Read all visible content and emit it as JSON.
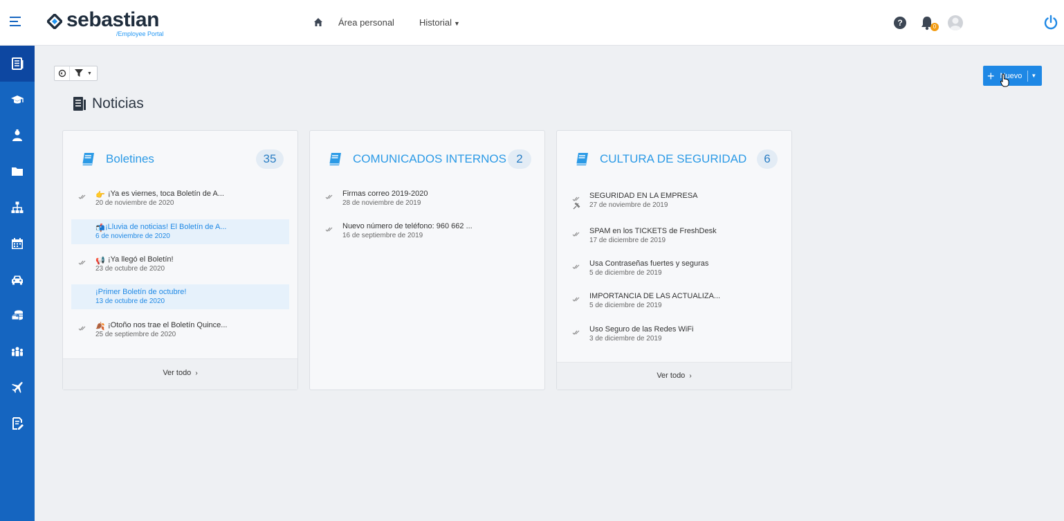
{
  "header": {
    "brand": "sebastian",
    "brand_sub": "/Employee Portal",
    "nav_area": "Área personal",
    "nav_history": "Historial",
    "help_symbol": "?",
    "notification_count": "0"
  },
  "sidebar": {
    "items": [
      {
        "icon": "newspaper-icon",
        "active": true
      },
      {
        "icon": "graduation-cap-icon"
      },
      {
        "icon": "user-badge-icon"
      },
      {
        "icon": "folder-icon"
      },
      {
        "icon": "org-chart-icon"
      },
      {
        "icon": "calendar-icon"
      },
      {
        "icon": "car-icon"
      },
      {
        "icon": "coins-icon"
      },
      {
        "icon": "team-icon"
      },
      {
        "icon": "plane-icon"
      },
      {
        "icon": "edit-document-icon"
      }
    ]
  },
  "toolbar": {
    "new_label": "Nuevo"
  },
  "page": {
    "title": "Noticias"
  },
  "cards": [
    {
      "title": "Boletines",
      "count": "35",
      "items": [
        {
          "emoji": "👉",
          "title": "¡Ya es viernes, toca Boletín de A...",
          "date": "20 de noviembre de 2020",
          "read": true,
          "highlight": false
        },
        {
          "emoji": "📬",
          "title": "¡Lluvia de noticias! El Boletín de A...",
          "date": "6 de noviembre de 2020",
          "read": false,
          "highlight": true
        },
        {
          "emoji": "📢",
          "title": "¡Ya llegó el Boletín!",
          "date": "23 de octubre de 2020",
          "read": true,
          "highlight": false
        },
        {
          "emoji": "",
          "title": "¡Primer Boletín de octubre!",
          "date": "13 de octubre de 2020",
          "read": false,
          "highlight": true
        },
        {
          "emoji": "🍂",
          "title": "¡Otoño nos trae el Boletín Quince...",
          "date": "25 de septiembre de 2020",
          "read": true,
          "highlight": false
        }
      ],
      "footer": "Ver todo"
    },
    {
      "title": "COMUNICADOS INTERNOS",
      "count": "2",
      "items": [
        {
          "title": "Firmas correo 2019-2020",
          "date": "28 de noviembre de 2019",
          "read": true
        },
        {
          "title": "Nuevo número de teléfono: 960 662 ...",
          "date": "16 de septiembre de 2019",
          "read": true
        }
      ]
    },
    {
      "title": "CULTURA DE SEGURIDAD",
      "count": "6",
      "items": [
        {
          "title": "SEGURIDAD EN LA EMPRESA",
          "date": "27 de noviembre de 2019",
          "read": true
        },
        {
          "title": "SPAM en los TICKETS de FreshDesk",
          "date": "17 de diciembre de 2019",
          "read": true
        },
        {
          "title": "Usa Contraseñas fuertes y seguras",
          "date": "5 de diciembre de 2019",
          "read": true
        },
        {
          "title": "IMPORTANCIA DE LAS ACTUALIZA...",
          "date": "5 de diciembre de 2019",
          "read": true
        },
        {
          "title": "Uso Seguro de las Redes WiFi",
          "date": "3 de diciembre de 2019",
          "read": true
        }
      ],
      "footer": "Ver todo"
    }
  ],
  "colors": {
    "primary": "#1565c0",
    "accent": "#1e88e5",
    "card_title": "#2b9ae6",
    "badge": "#f39c12"
  }
}
